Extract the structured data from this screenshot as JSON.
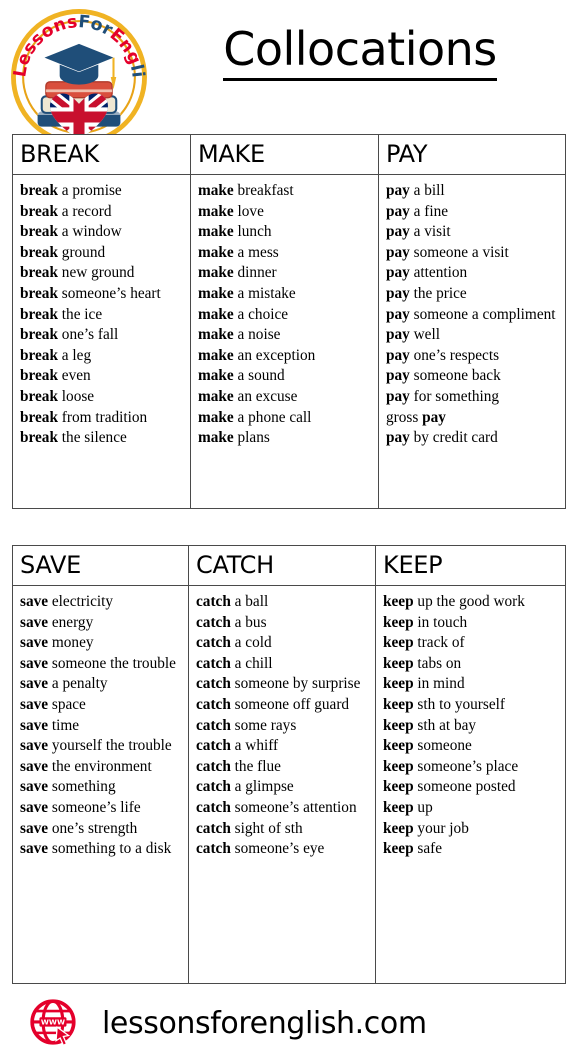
{
  "header": {
    "title": "Collocations",
    "logo_alt": "LessonsForEnglish.Com"
  },
  "tables": [
    {
      "id": "table-1",
      "columns": [
        {
          "heading": "BREAK",
          "items": [
            {
              "verb": "break",
              "rest": " a promise"
            },
            {
              "verb": "break",
              "rest": " a record"
            },
            {
              "verb": "break",
              "rest": " a window"
            },
            {
              "verb": "break",
              "rest": " ground"
            },
            {
              "verb": "break",
              "rest": " new ground"
            },
            {
              "verb": "break",
              "rest": " someone’s heart"
            },
            {
              "verb": "break",
              "rest": " the ice"
            },
            {
              "verb": "break",
              "rest": " one’s fall"
            },
            {
              "verb": "break",
              "rest": " a leg"
            },
            {
              "verb": "break",
              "rest": " even"
            },
            {
              "verb": "break",
              "rest": " loose"
            },
            {
              "verb": "break",
              "rest": " from tradition"
            },
            {
              "verb": "break",
              "rest": " the silence"
            }
          ]
        },
        {
          "heading": "MAKE",
          "items": [
            {
              "verb": "make",
              "rest": " breakfast"
            },
            {
              "verb": "make",
              "rest": " love"
            },
            {
              "verb": "make",
              "rest": " lunch"
            },
            {
              "verb": "make",
              "rest": " a mess"
            },
            {
              "verb": "make",
              "rest": " dinner"
            },
            {
              "verb": "make",
              "rest": " a mistake"
            },
            {
              "verb": "make",
              "rest": " a choice"
            },
            {
              "verb": "make",
              "rest": " a noise"
            },
            {
              "verb": "make",
              "rest": " an exception"
            },
            {
              "verb": "make",
              "rest": " a sound"
            },
            {
              "verb": "make",
              "rest": " an excuse"
            },
            {
              "verb": "make",
              "rest": " a phone call"
            },
            {
              "verb": "make",
              "rest": " plans"
            }
          ]
        },
        {
          "heading": "PAY",
          "items": [
            {
              "verb": "pay",
              "rest": " a bill"
            },
            {
              "verb": "pay",
              "rest": " a fine"
            },
            {
              "verb": "pay",
              "rest": " a visit"
            },
            {
              "verb": "pay",
              "rest": " someone a visit"
            },
            {
              "verb": "pay",
              "rest": " attention"
            },
            {
              "verb": "pay",
              "rest": " the price"
            },
            {
              "verb": "pay",
              "rest": " someone a compliment"
            },
            {
              "verb": "pay",
              "rest": " well"
            },
            {
              "verb": "pay",
              "rest": " one’s respects"
            },
            {
              "verb": "pay",
              "rest": " someone back"
            },
            {
              "verb": "pay",
              "rest": " for something"
            },
            {
              "prefix": "gross ",
              "verb": "pay",
              "rest": ""
            },
            {
              "verb": "pay",
              "rest": " by credit card"
            }
          ]
        }
      ]
    },
    {
      "id": "table-2",
      "columns": [
        {
          "heading": "SAVE",
          "items": [
            {
              "verb": "save",
              "rest": " electricity"
            },
            {
              "verb": "save",
              "rest": " energy"
            },
            {
              "verb": "save",
              "rest": " money"
            },
            {
              "verb": "save",
              "rest": " someone the trouble"
            },
            {
              "verb": "save",
              "rest": " a penalty"
            },
            {
              "verb": "save",
              "rest": " space"
            },
            {
              "verb": "save",
              "rest": " time"
            },
            {
              "verb": "save",
              "rest": " yourself the trouble"
            },
            {
              "verb": "save",
              "rest": " the environment"
            },
            {
              "verb": "save",
              "rest": " something"
            },
            {
              "verb": "save",
              "rest": " someone’s life"
            },
            {
              "verb": "save",
              "rest": " one’s strength"
            },
            {
              "verb": "save",
              "rest": " something to a disk"
            }
          ]
        },
        {
          "heading": "CATCH",
          "items": [
            {
              "verb": "catch",
              "rest": " a ball"
            },
            {
              "verb": "catch",
              "rest": " a bus"
            },
            {
              "verb": "catch",
              "rest": " a cold"
            },
            {
              "verb": "catch",
              "rest": " a chill"
            },
            {
              "verb": "catch",
              "rest": " someone by surprise"
            },
            {
              "verb": "catch",
              "rest": " someone off guard"
            },
            {
              "verb": "catch",
              "rest": " some rays"
            },
            {
              "verb": "catch",
              "rest": " a whiff"
            },
            {
              "verb": "catch",
              "rest": " the flue"
            },
            {
              "verb": "catch",
              "rest": " a glimpse"
            },
            {
              "verb": "catch",
              "rest": " someone’s attention"
            },
            {
              "verb": "catch",
              "rest": " sight of sth"
            },
            {
              "verb": "catch",
              "rest": " someone’s eye"
            }
          ]
        },
        {
          "heading": "KEEP",
          "items": [
            {
              "verb": "keep",
              "rest": " up the good work"
            },
            {
              "verb": "keep",
              "rest": " in touch"
            },
            {
              "verb": "keep",
              "rest": " track of"
            },
            {
              "verb": "keep",
              "rest": " tabs on"
            },
            {
              "verb": "keep",
              "rest": " in mind"
            },
            {
              "verb": "keep",
              "rest": " sth to yourself"
            },
            {
              "verb": "keep",
              "rest": " sth at bay"
            },
            {
              "verb": "keep",
              "rest": " someone"
            },
            {
              "verb": "keep",
              "rest": " someone’s place"
            },
            {
              "verb": "keep",
              "rest": " someone posted"
            },
            {
              "verb": "keep",
              "rest": " up"
            },
            {
              "verb": "keep",
              "rest": " your job"
            },
            {
              "verb": "keep",
              "rest": " safe"
            }
          ]
        }
      ]
    }
  ],
  "footer": {
    "website": "lessonsforenglish.com",
    "icon": "www-globe-icon"
  },
  "colors": {
    "text": "#000000",
    "border": "#4a4a4a",
    "brand_red": "#e4002b",
    "brand_gold": "#f0b323",
    "brand_blue": "#1f4e79"
  }
}
